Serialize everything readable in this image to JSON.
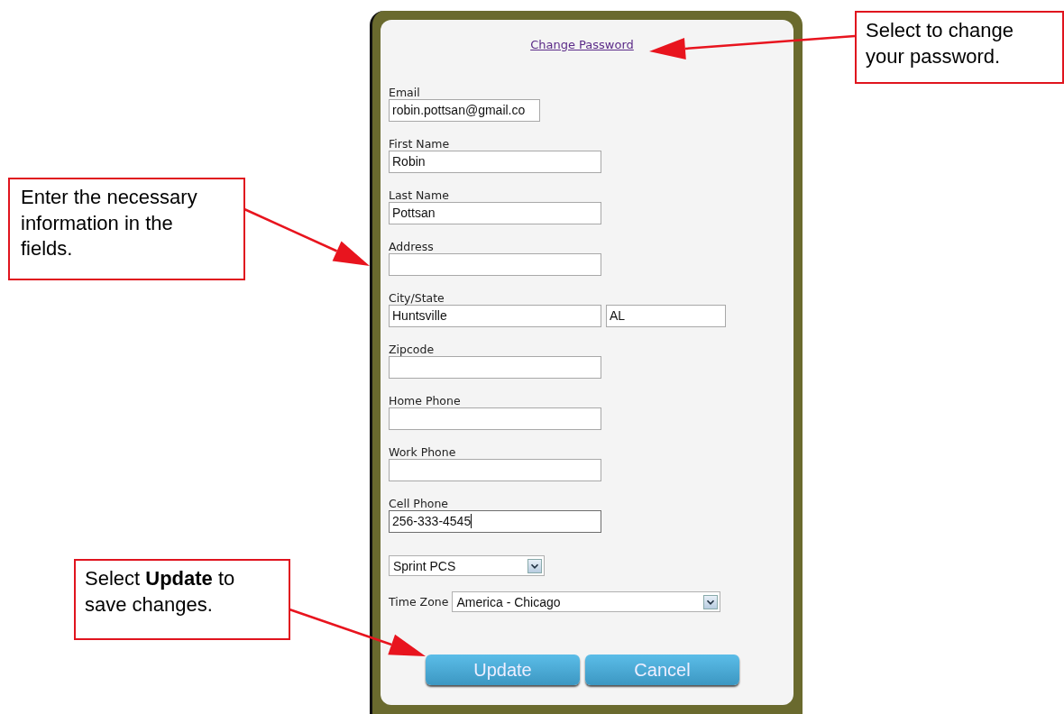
{
  "link": {
    "label": "Change Password"
  },
  "fields": [
    {
      "kind": "email",
      "label": "Email",
      "value": "robin.pottsan@gmail.co",
      "focused": false
    },
    {
      "kind": "text",
      "label": "First Name",
      "value": "Robin",
      "focused": false
    },
    {
      "kind": "text",
      "label": "Last Name",
      "value": "Pottsan",
      "focused": false
    },
    {
      "kind": "text",
      "label": "Address",
      "focused": false
    },
    {
      "kind": "pair",
      "label": "City/State",
      "value": "Huntsville",
      "value_2": "AL",
      "focused": false
    },
    {
      "kind": "text",
      "label": "Zipcode",
      "focused": false
    },
    {
      "kind": "text",
      "label": "Home Phone",
      "focused": false
    },
    {
      "kind": "text",
      "label": "Work Phone",
      "focused": false
    },
    {
      "kind": "text",
      "label": "Cell Phone",
      "value": "256-333-4545",
      "focused": true
    },
    {
      "kind": "select",
      "value": "Sprint PCS"
    },
    {
      "kind": "labeled-select",
      "label": "Time Zone",
      "value": "America - Chicago"
    }
  ],
  "buttons": [
    "Update",
    "Cancel"
  ],
  "callouts": [
    {
      "text": "Select to change your password."
    },
    {
      "text": "Enter the necessary information in the fields."
    },
    {
      "text": "Select **Update** to save changes."
    }
  ]
}
